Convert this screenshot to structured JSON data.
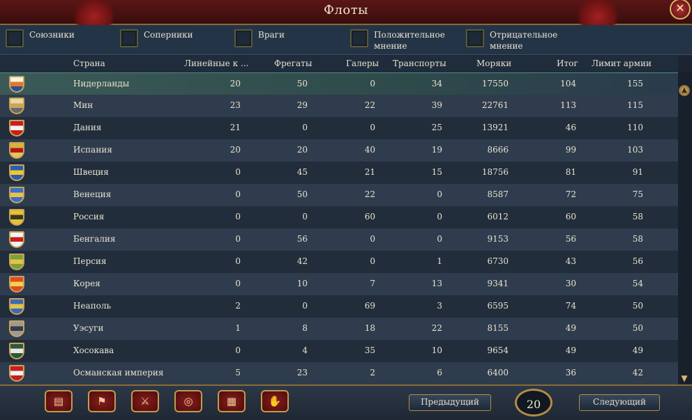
{
  "window": {
    "title": "Флоты",
    "close_icon": "✕"
  },
  "filters": [
    {
      "label": "Союзники"
    },
    {
      "label": "Соперники"
    },
    {
      "label": "Враги"
    },
    {
      "label": "Положительное мнение"
    },
    {
      "label": "Отрицательное мнение"
    }
  ],
  "columns": {
    "country": "Страна",
    "ships_of_line": "Линейные к ...",
    "frigates": "Фрегаты",
    "galleys": "Галеры",
    "transports": "Транспорты",
    "sailors": "Моряки",
    "total": "Итог",
    "army_limit": "Лимит армии"
  },
  "rows": [
    {
      "country": "Нидерланды",
      "ships_of_line": "20",
      "frigates": "50",
      "galleys": "0",
      "transports": "34",
      "sailors": "17550",
      "total": "104",
      "army_limit": "155",
      "flag": [
        "#f7f2e6",
        "#e07a2a",
        "#2a4fa0"
      ]
    },
    {
      "country": "Мин",
      "ships_of_line": "23",
      "frigates": "29",
      "galleys": "22",
      "transports": "39",
      "sailors": "22761",
      "total": "113",
      "army_limit": "115",
      "flag": [
        "#e8d9a0",
        "#c9a45a",
        "#6a6a6a"
      ]
    },
    {
      "country": "Дания",
      "ships_of_line": "21",
      "frigates": "0",
      "galleys": "0",
      "transports": "25",
      "sailors": "13921",
      "total": "46",
      "army_limit": "110",
      "flag": [
        "#c81e1e",
        "#f2f2f2",
        "#c81e1e"
      ]
    },
    {
      "country": "Испания",
      "ships_of_line": "20",
      "frigates": "20",
      "galleys": "40",
      "transports": "19",
      "sailors": "8666",
      "total": "99",
      "army_limit": "103",
      "flag": [
        "#d9b23a",
        "#b01818",
        "#e3c45a"
      ]
    },
    {
      "country": "Швеция",
      "ships_of_line": "0",
      "frigates": "45",
      "galleys": "21",
      "transports": "15",
      "sailors": "18756",
      "total": "81",
      "army_limit": "91",
      "flag": [
        "#2a5cb8",
        "#f2c72a",
        "#2a5cb8"
      ]
    },
    {
      "country": "Венеция",
      "ships_of_line": "0",
      "frigates": "50",
      "galleys": "22",
      "transports": "0",
      "sailors": "8587",
      "total": "72",
      "army_limit": "75",
      "flag": [
        "#3a70c8",
        "#e8c24a",
        "#3a70c8"
      ]
    },
    {
      "country": "Россия",
      "ships_of_line": "0",
      "frigates": "0",
      "galleys": "60",
      "transports": "0",
      "sailors": "6012",
      "total": "60",
      "army_limit": "58",
      "flag": [
        "#e3c23a",
        "#3a3a1a",
        "#e3c23a"
      ]
    },
    {
      "country": "Бенгалия",
      "ships_of_line": "0",
      "frigates": "56",
      "galleys": "0",
      "transports": "0",
      "sailors": "9153",
      "total": "56",
      "army_limit": "58",
      "flag": [
        "#f2f2f2",
        "#c02020",
        "#f2f2f2"
      ]
    },
    {
      "country": "Персия",
      "ships_of_line": "0",
      "frigates": "42",
      "galleys": "0",
      "transports": "1",
      "sailors": "6730",
      "total": "43",
      "army_limit": "56",
      "flag": [
        "#7aa23a",
        "#e3c24a",
        "#7aa23a"
      ]
    },
    {
      "country": "Корея",
      "ships_of_line": "0",
      "frigates": "10",
      "galleys": "7",
      "transports": "13",
      "sailors": "9341",
      "total": "30",
      "army_limit": "54",
      "flag": [
        "#e04a2a",
        "#f2d24a",
        "#e04a2a"
      ]
    },
    {
      "country": "Неаполь",
      "ships_of_line": "2",
      "frigates": "0",
      "galleys": "69",
      "transports": "3",
      "sailors": "6595",
      "total": "74",
      "army_limit": "50",
      "flag": [
        "#3a6ab8",
        "#e3c24a",
        "#3a6ab8"
      ]
    },
    {
      "country": "Уэсуги",
      "ships_of_line": "1",
      "frigates": "8",
      "galleys": "18",
      "transports": "22",
      "sailors": "8155",
      "total": "49",
      "army_limit": "50",
      "flag": [
        "#9a9a9a",
        "#3a3a3a",
        "#9a9a9a"
      ]
    },
    {
      "country": "Хосокава",
      "ships_of_line": "0",
      "frigates": "4",
      "galleys": "35",
      "transports": "10",
      "sailors": "9654",
      "total": "49",
      "army_limit": "49",
      "flag": [
        "#2a5a3a",
        "#e8e8e8",
        "#2a5a3a"
      ]
    },
    {
      "country": "Османская империя",
      "ships_of_line": "5",
      "frigates": "23",
      "galleys": "2",
      "transports": "6",
      "sailors": "6400",
      "total": "36",
      "army_limit": "42",
      "flag": [
        "#c81e1e",
        "#f2f2f2",
        "#c81e1e"
      ]
    }
  ],
  "toolbar": [
    {
      "name": "ledger-button",
      "icon": "ledger-icon",
      "glyph": "▤"
    },
    {
      "name": "flags-button",
      "icon": "flag-icon",
      "glyph": "⚑"
    },
    {
      "name": "military-button",
      "icon": "crossed-swords-icon",
      "glyph": "⚔"
    },
    {
      "name": "economy-button",
      "icon": "coins-icon",
      "glyph": "◎"
    },
    {
      "name": "trade-button",
      "icon": "crates-icon",
      "glyph": "▦"
    },
    {
      "name": "diplomacy-button",
      "icon": "handshake-icon",
      "glyph": "✋"
    }
  ],
  "pagination": {
    "previous_label": "Предыдущий",
    "next_label": "Следующий",
    "page_number": "20"
  },
  "scrollbar": {
    "up_glyph": "▲",
    "down_glyph": "▼"
  },
  "colors": {
    "title_bar": "#5a1616",
    "selected_row": "#3b5a57",
    "gold_border": "#c9a456"
  }
}
